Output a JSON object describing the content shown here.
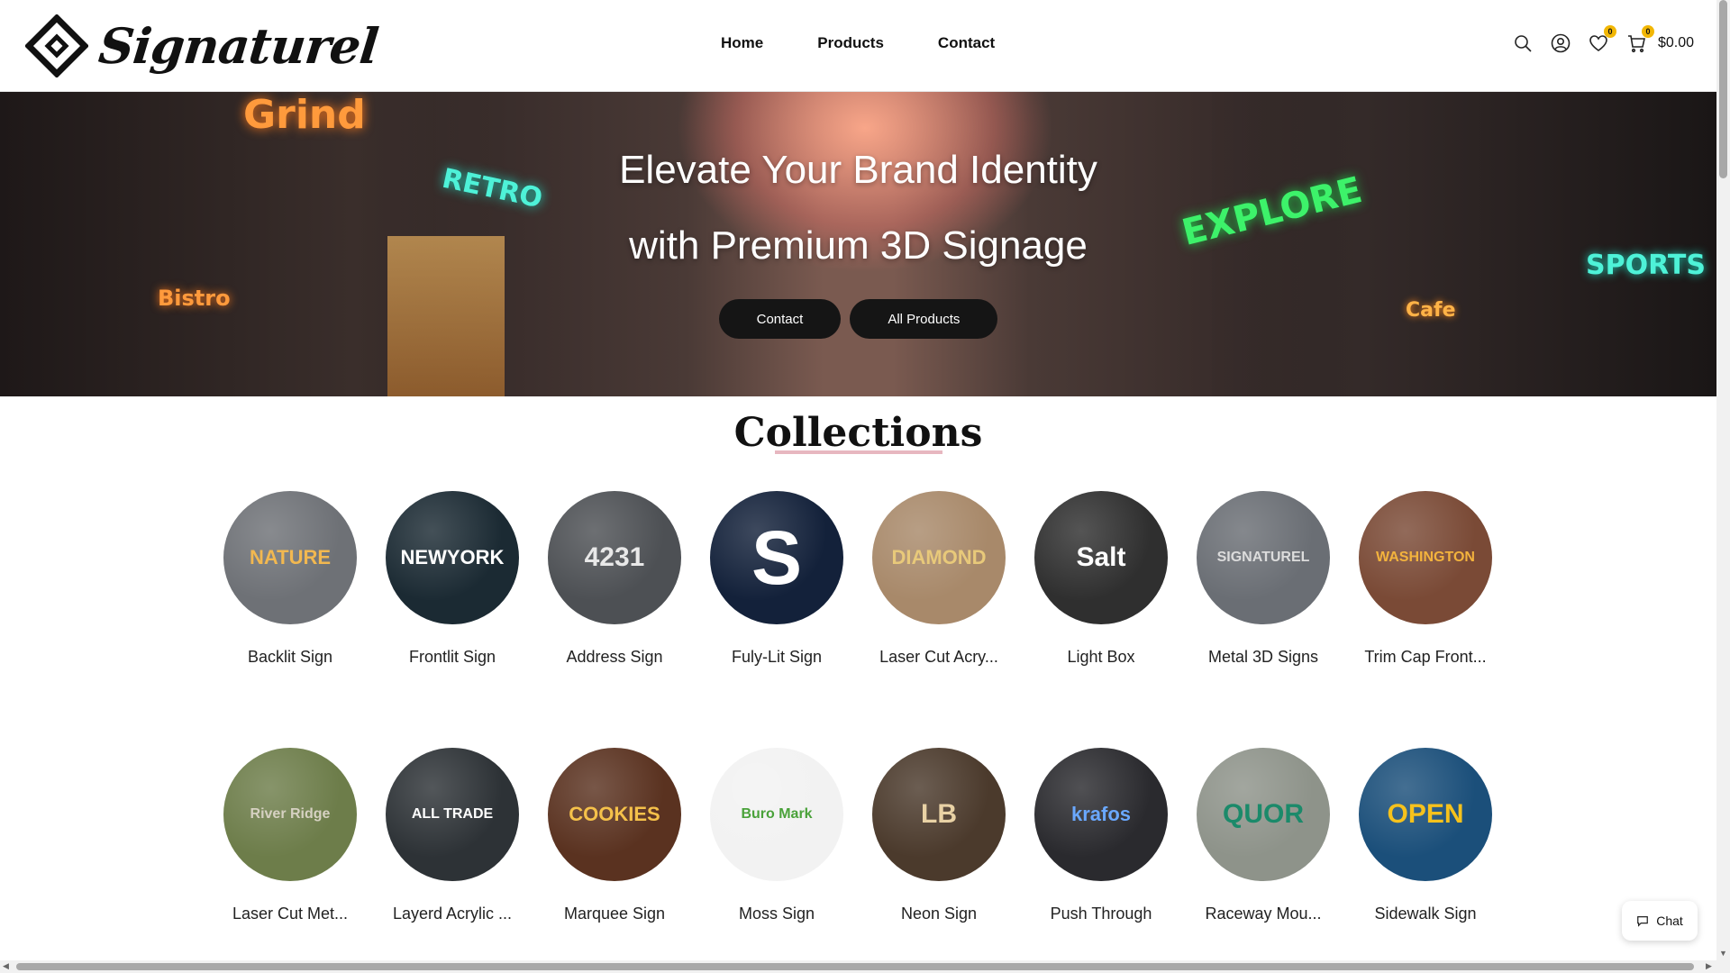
{
  "brand": {
    "name": "Signaturel"
  },
  "nav": {
    "items": [
      "Home",
      "Products",
      "Contact"
    ]
  },
  "header": {
    "wishlist_count": "0",
    "cart_count": "0",
    "cart_total": "$0.00"
  },
  "hero": {
    "title_line1": "Elevate Your Brand Identity",
    "title_line2": "with Premium 3D Signage",
    "button_contact": "Contact",
    "button_all_products": "All Products"
  },
  "collections": {
    "title": "Collections",
    "items": [
      {
        "label": "Backlit Sign",
        "thumb_text": "NATURE",
        "bg": "#6e7176",
        "fg": "#f2b850"
      },
      {
        "label": "Frontlit Sign",
        "thumb_text": "NEWYORK",
        "bg": "#1b2a33",
        "fg": "#ffffff"
      },
      {
        "label": "Address Sign",
        "thumb_text": "4231",
        "bg": "#4d5054",
        "fg": "#e8e8e8"
      },
      {
        "label": "Fuly-Lit Sign",
        "thumb_text": "S",
        "bg": "#13213a",
        "fg": "#ffffff"
      },
      {
        "label": "Laser Cut Acry...",
        "thumb_text": "DIAMOND",
        "bg": "#a8896a",
        "fg": "#e8c97a"
      },
      {
        "label": "Light Box",
        "thumb_text": "Salt",
        "bg": "#2f2f2f",
        "fg": "#ffffff"
      },
      {
        "label": "Metal 3D Signs",
        "thumb_text": "SIGNATUREL",
        "bg": "#6a6e74",
        "fg": "#dcdcdc"
      },
      {
        "label": "Trim Cap Front...",
        "thumb_text": "WASHINGTON",
        "bg": "#7a4a36",
        "fg": "#f3b33d"
      },
      {
        "label": "Laser Cut Met...",
        "thumb_text": "River Ridge",
        "bg": "#6d7d4a",
        "fg": "#d6d1c2"
      },
      {
        "label": "Layerd Acrylic ...",
        "thumb_text": "ALL TRADE",
        "bg": "#2d3236",
        "fg": "#ffffff"
      },
      {
        "label": "Marquee Sign",
        "thumb_text": "COOKIES",
        "bg": "#5a3220",
        "fg": "#f5c14a"
      },
      {
        "label": "Moss Sign",
        "thumb_text": "Buro Mark",
        "bg": "#f2f2f2",
        "fg": "#4aa23a"
      },
      {
        "label": "Neon Sign",
        "thumb_text": "LB",
        "bg": "#4b3a2c",
        "fg": "#e9d2a5"
      },
      {
        "label": "Push Through",
        "thumb_text": "krafos",
        "bg": "#2a2a2e",
        "fg": "#6aa8ff"
      },
      {
        "label": "Raceway Mou...",
        "thumb_text": "QUOR",
        "bg": "#8e938a",
        "fg": "#1b8a6a"
      },
      {
        "label": "Sidewalk Sign",
        "thumb_text": "OPEN",
        "bg": "#1b4f7a",
        "fg": "#f6c21c"
      }
    ]
  },
  "chat": {
    "label": "Chat"
  },
  "colors": {
    "accent_underline": "#e7b7c0",
    "button_dark": "#151515",
    "badge": "#f2b705"
  }
}
